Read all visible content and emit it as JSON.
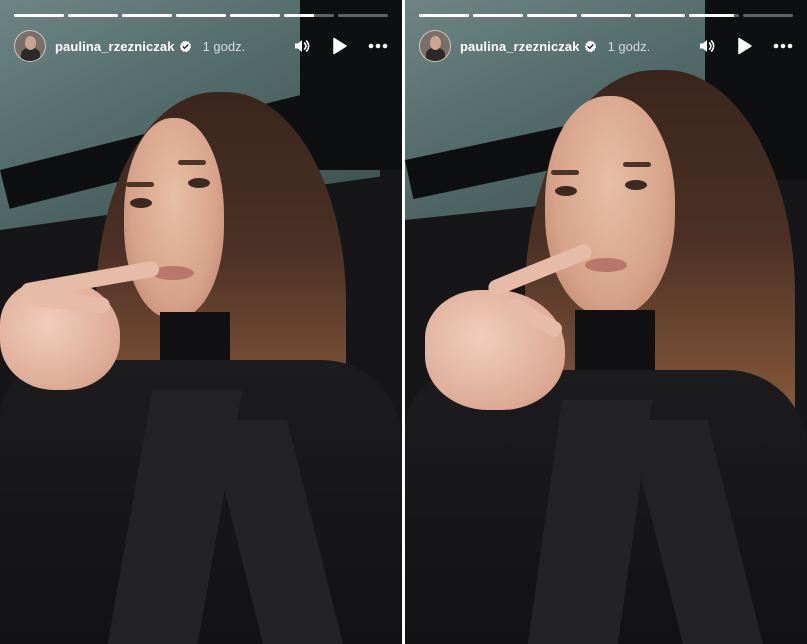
{
  "colors": {
    "overlay_text": "#ffffff",
    "progress_track": "rgba(255,255,255,0.35)",
    "progress_fill": "#ffffff",
    "verified_badge": "#ffffff"
  },
  "stories": [
    {
      "username": "paulina_rzezniczak",
      "timestamp": "1 godz.",
      "verified": true,
      "progress_segments": [
        1,
        1,
        1,
        1,
        1,
        0.6,
        0
      ],
      "icons": {
        "avatar": "profile-avatar",
        "verified": "verified-badge-icon",
        "sound": "speaker-icon",
        "play": "play-icon",
        "more": "more-options-icon"
      }
    },
    {
      "username": "paulina_rzezniczak",
      "timestamp": "1 godz.",
      "verified": true,
      "progress_segments": [
        1,
        1,
        1,
        1,
        1,
        0.9,
        0
      ],
      "icons": {
        "avatar": "profile-avatar",
        "verified": "verified-badge-icon",
        "sound": "speaker-icon",
        "play": "play-icon",
        "more": "more-options-icon"
      }
    }
  ]
}
